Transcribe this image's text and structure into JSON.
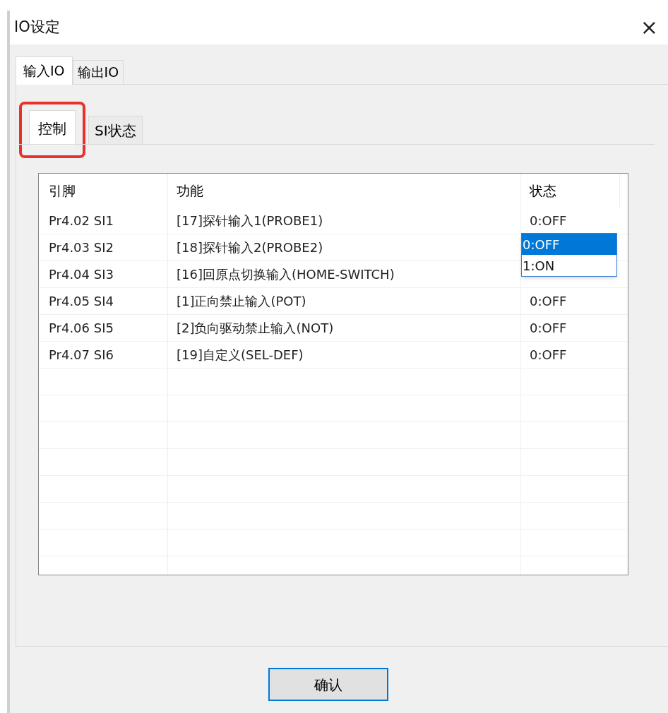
{
  "window": {
    "title": "IO设定",
    "close": "×"
  },
  "tabs": [
    {
      "label": "输入IO",
      "selected": true
    },
    {
      "label": "输出IO",
      "selected": false
    }
  ],
  "subtabs": [
    {
      "label": "控制",
      "selected": true,
      "highlighted": true
    },
    {
      "label": "SI状态",
      "selected": false,
      "highlighted": false
    }
  ],
  "table": {
    "columns": [
      "引脚",
      "功能",
      "状态"
    ],
    "rows": [
      {
        "pin": "Pr4.02 SI1",
        "function": "[17]探针输入1(PROBE1)",
        "status": "0:OFF"
      },
      {
        "pin": "Pr4.03 SI2",
        "function": "[18]探针输入2(PROBE2)",
        "dropdown": [
          {
            "label": "0:OFF",
            "selected": true
          },
          {
            "label": "1:ON",
            "selected": false
          }
        ]
      },
      {
        "pin": "Pr4.04 SI3",
        "function": "[16]回原点切换输入(HOME-SWITCH)"
      },
      {
        "pin": "Pr4.05 SI4",
        "function": "[1]正向禁止输入(POT)",
        "status": "0:OFF"
      },
      {
        "pin": "Pr4.06 SI5",
        "function": "[2]负向驱动禁止输入(NOT)",
        "status": "0:OFF"
      },
      {
        "pin": "Pr4.07 SI6",
        "function": "[19]自定义(SEL-DEF)",
        "status": "0:OFF"
      }
    ]
  },
  "buttons": [
    "确认"
  ]
}
